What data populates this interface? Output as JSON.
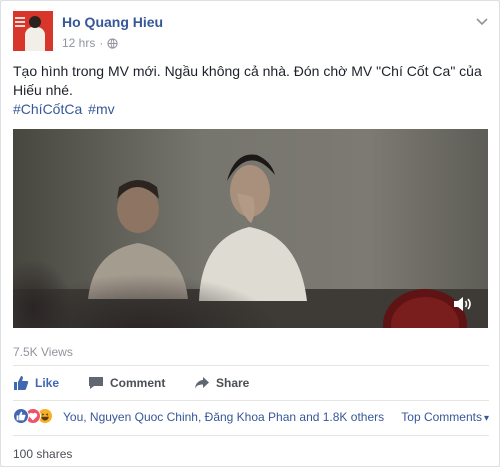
{
  "post": {
    "author": "Ho Quang Hieu",
    "time": "12 hrs",
    "separator": "·",
    "text": "Tạo hình trong MV mới. Ngầu không cả nhà. Đón chờ MV \"Chí Cốt Ca\" của Hiếu nhé.",
    "hashtags": [
      "#ChíCốtCa",
      "#mv"
    ]
  },
  "video": {
    "views": "7.5K Views",
    "sound_icon": "speaker-icon"
  },
  "actions": {
    "like": "Like",
    "comment": "Comment",
    "share": "Share"
  },
  "reactions": {
    "types": [
      "like",
      "love",
      "haha"
    ],
    "names": "You, Nguyen Quoc Chinh, Đăng Khoa Phan and 1.8K others",
    "sort_label": "Top Comments",
    "sort_caret": "▾"
  },
  "shares": "100 shares",
  "colors": {
    "link": "#365899",
    "like_blue": "#4267b2",
    "love_red": "#f25268",
    "haha_yellow": "#f7b125"
  }
}
